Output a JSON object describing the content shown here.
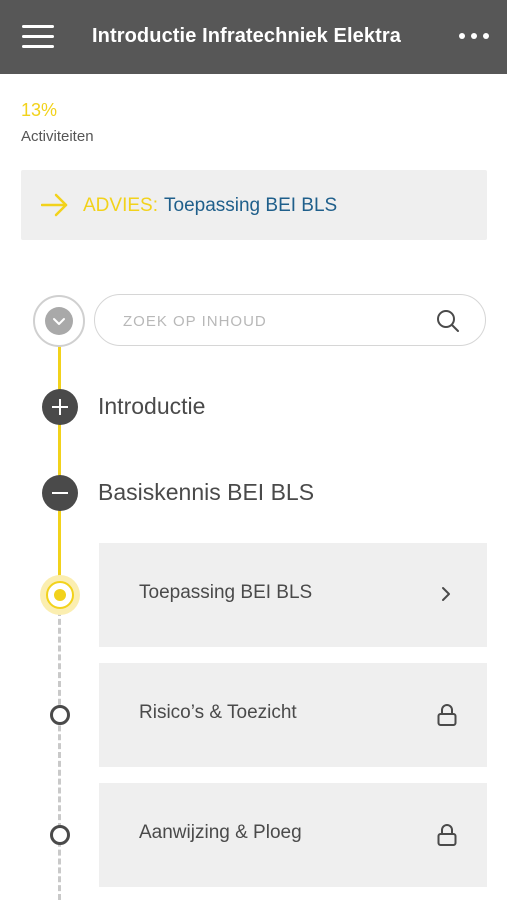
{
  "header": {
    "title": "Introductie Infratechniek Elektra",
    "menu_icon": "hamburger-icon",
    "more_icon": "more-dots-icon"
  },
  "progress": {
    "percent": "13%",
    "label": "Activiteiten"
  },
  "advice": {
    "label": "ADVIES:",
    "link": "Toepassing BEI BLS",
    "icon": "arrow-right-icon"
  },
  "search": {
    "placeholder": "ZOEK OP INHOUD",
    "value": "",
    "icon": "search-icon"
  },
  "sections": [
    {
      "title": "Introductie",
      "state": "collapsed",
      "icon": "plus-icon"
    },
    {
      "title": "Basiskennis BEI BLS",
      "state": "expanded",
      "icon": "minus-icon"
    }
  ],
  "lessons": [
    {
      "label": "Toepassing BEI BLS",
      "status": "active",
      "icon": "chevron-right-icon"
    },
    {
      "label": "Risico’s & Toezicht",
      "status": "locked",
      "icon": "lock-icon"
    },
    {
      "label": "Aanwijzing & Ploeg",
      "status": "locked",
      "icon": "lock-icon"
    }
  ],
  "colors": {
    "header_bg": "#575757",
    "accent_yellow": "#f2d21b",
    "link_blue": "#1f5f8b",
    "card_bg": "#efefef",
    "text_dark": "#4a4a4a"
  }
}
